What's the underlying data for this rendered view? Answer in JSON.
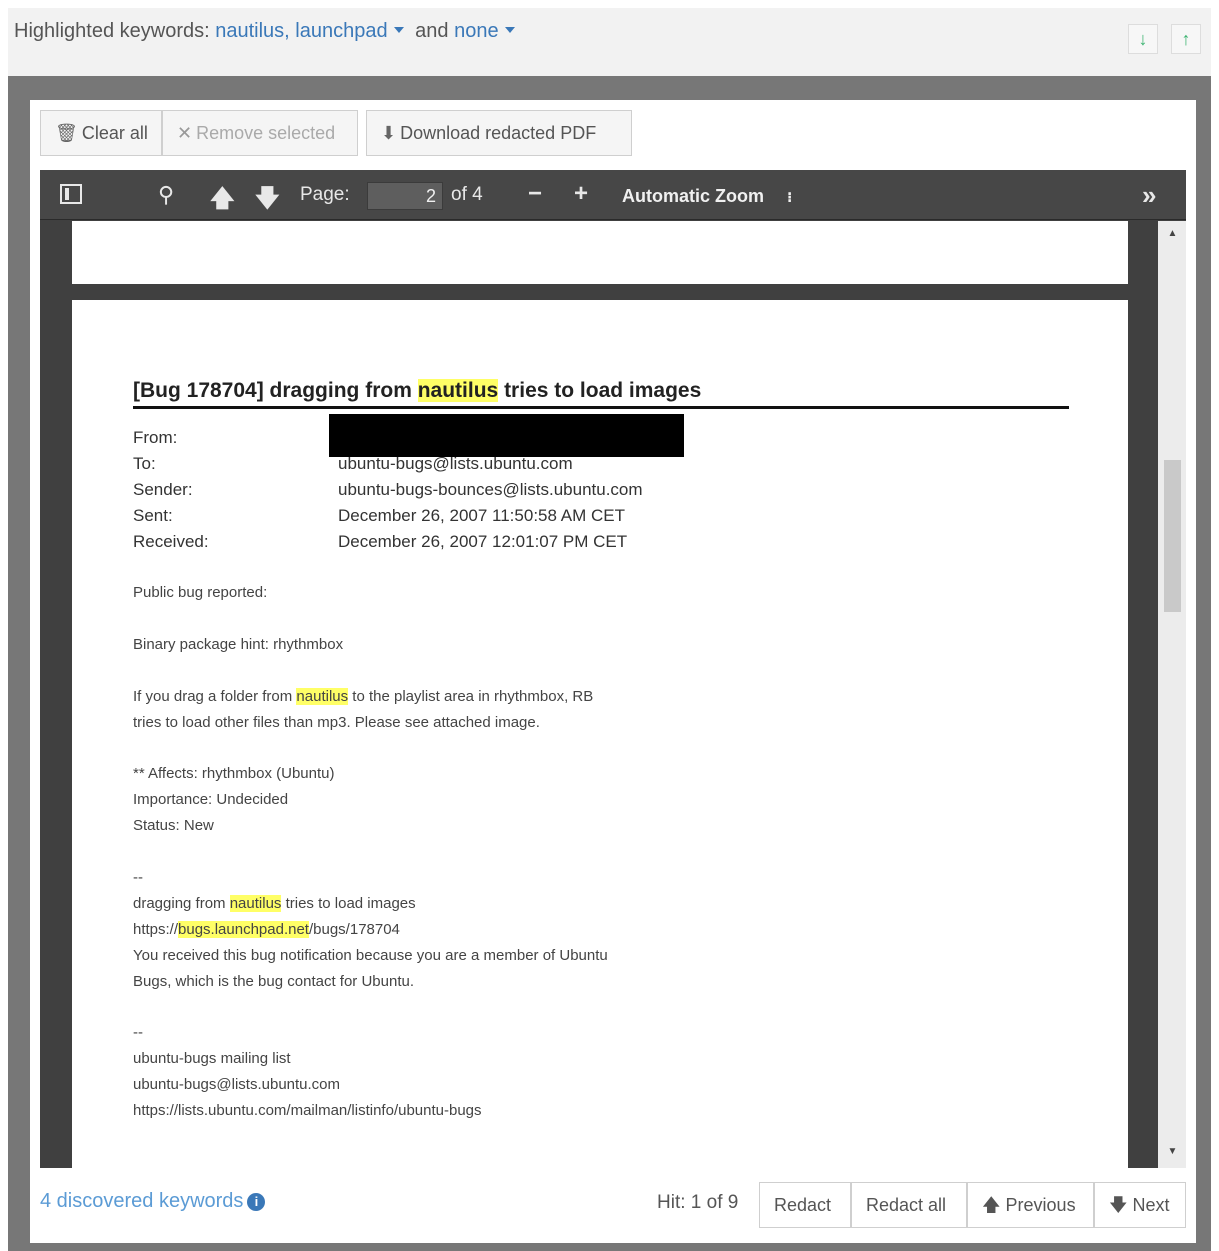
{
  "keywords_bar": {
    "prefix": "Highlighted keywords:",
    "kw1": "nautilus,",
    "kw2": "launchpad",
    "conj": "and",
    "kw3": "none",
    "down_icon": "arrow-down-icon",
    "up_icon": "arrow-up-icon"
  },
  "toolbar": {
    "clear_all": "Clear all",
    "remove_selected": "Remove selected",
    "download": "Download redacted PDF"
  },
  "viewer": {
    "page_label": "Page:",
    "page_value": "2",
    "of_pages": "of 4",
    "zoom": "Automatic Zoom",
    "zoom_caret": "↕"
  },
  "document": {
    "title_pre": "[Bug 178704] dragging from ",
    "title_hl": "nautilus",
    "title_post": " tries to load images",
    "headers": [
      {
        "label": "From:",
        "value": ""
      },
      {
        "label": "To:",
        "value": "ubuntu-bugs@lists.ubuntu.com"
      },
      {
        "label": "Sender:",
        "value": "ubuntu-bugs-bounces@lists.ubuntu.com"
      },
      {
        "label": "Sent:",
        "value": "December 26, 2007 11:50:58 AM CET"
      },
      {
        "label": "Received:",
        "value": "December 26, 2007 12:01:07 PM CET"
      }
    ],
    "l_public": "Public bug reported:",
    "l_binary": "Binary package hint: rhythmbox",
    "l_drag1_pre": "If you drag a folder from ",
    "l_drag1_hl": "nautilus",
    "l_drag1_post": " to the playlist area in rhythmbox, RB",
    "l_drag2": "tries to load other files than mp3. Please see attached image.",
    "l_affects": "** Affects: rhythmbox (Ubuntu)",
    "l_importance": "Importance: Undecided",
    "l_status": "Status: New",
    "l_dash1": "--",
    "l_sig_pre": "dragging from ",
    "l_sig_hl": "nautilus",
    "l_sig_post": " tries to load images",
    "l_url_pre": "https://",
    "l_url_hl": "bugs.launchpad.net",
    "l_url_post": "/bugs/178704",
    "l_received1": "You received this bug notification because you are a member of Ubuntu",
    "l_received2": "Bugs, which is the bug contact for Ubuntu.",
    "l_dash2": "--",
    "l_list": "ubuntu-bugs mailing list",
    "l_email": "ubuntu-bugs@lists.ubuntu.com",
    "l_listurl": "https://lists.ubuntu.com/mailman/listinfo/ubuntu-bugs"
  },
  "footer": {
    "discovered": "4 discovered keywords",
    "hit": "Hit: 1 of 9",
    "redact": "Redact",
    "redact_all": "Redact all",
    "previous": "Previous",
    "next": "Next"
  },
  "colors": {
    "accent": "#3a78b8",
    "highlight": "#ffff66",
    "green_arrow": "#3cb371",
    "viewer_bg": "#404040"
  }
}
